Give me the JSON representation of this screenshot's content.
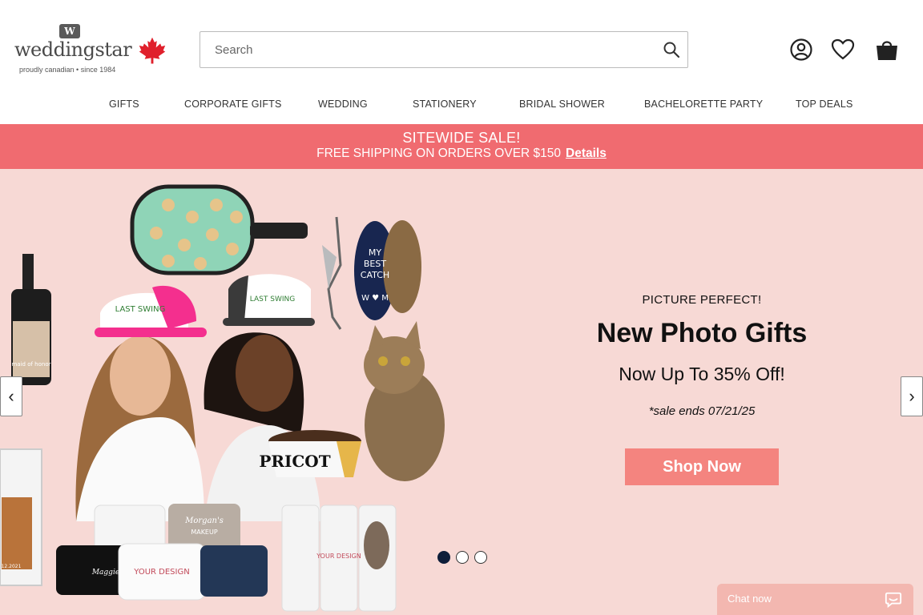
{
  "brand": {
    "logo_mark": "W",
    "name": "weddingstar",
    "tagline": "proudly canadian • since 1984"
  },
  "search": {
    "placeholder": "Search"
  },
  "nav": {
    "items": [
      "GIFTS",
      "CORPORATE GIFTS",
      "WEDDING",
      "STATIONERY",
      "BRIDAL SHOWER",
      "BACHELORETTE PARTY",
      "TOP DEALS"
    ]
  },
  "promo": {
    "line1": "SITEWIDE SALE!",
    "line2": "FREE SHIPPING ON ORDERS OVER $150",
    "link": "Details"
  },
  "hero": {
    "eyebrow": "PICTURE PERFECT!",
    "headline": "New Photo Gifts",
    "subhead": "Now Up To 35% Off!",
    "fine": "*sale ends 07/21/25",
    "cta": "Shop Now",
    "prev": "‹",
    "next": "›",
    "art_texts": {
      "keychain": [
        "MY",
        "BEST",
        "CATCH",
        "W ♥ M"
      ],
      "bowl": "PRICOT",
      "cap": "LAST SWING",
      "tumbler": "YOUR DESIGN",
      "pouch": "YOUR DESIGN",
      "pouch_name": "Maggie",
      "wine": "maid of honor",
      "bag_name": "Morgan's",
      "bag_word": "MAKEUP",
      "lantern_date": "12.2021"
    },
    "slides_total": 3,
    "slide_active": 1
  },
  "chat": {
    "label": "Chat now"
  },
  "colors": {
    "promo_bg": "#f06b70",
    "hero_bg": "#f7d9d5",
    "cta_bg": "#f4847f",
    "dot_active": "#0e1e3a",
    "maple": "#e0202c"
  },
  "icons": [
    "search-icon",
    "account-icon",
    "heart-icon",
    "shopping-bag-icon",
    "maple-leaf-icon",
    "chat-bubble-icon"
  ]
}
